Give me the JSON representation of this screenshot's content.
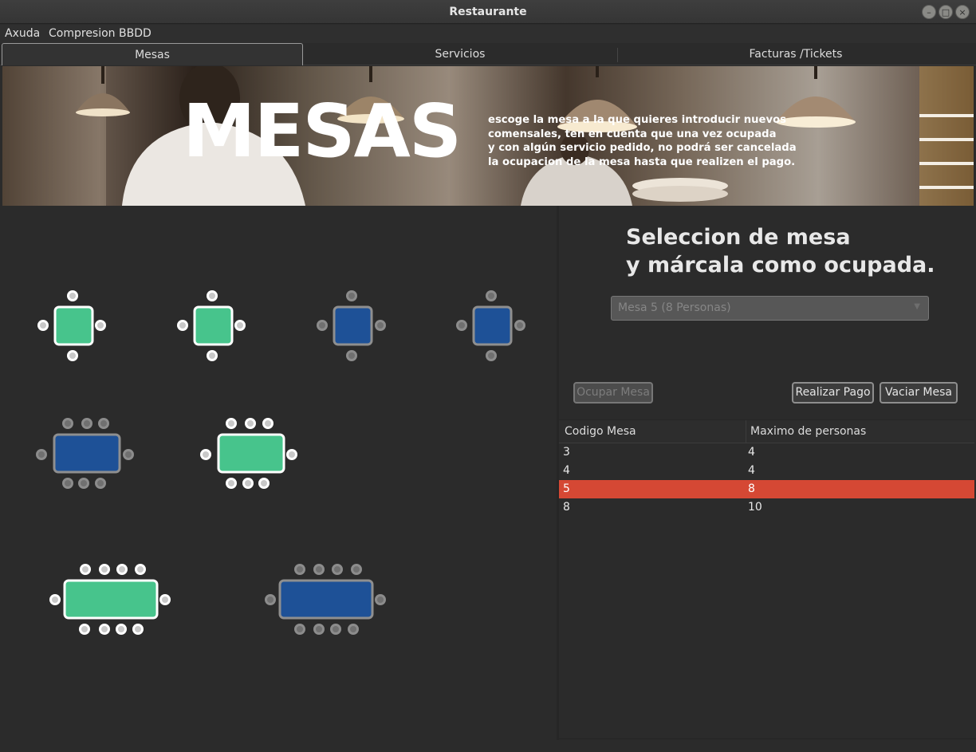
{
  "window": {
    "title": "Restaurante"
  },
  "menu": [
    {
      "label": "Axuda"
    },
    {
      "label": "Compresion BBDD"
    }
  ],
  "tabs": [
    {
      "label": "Mesas"
    },
    {
      "label": "Servicios"
    },
    {
      "label": "Facturas /Tickets"
    }
  ],
  "banner": {
    "title": "MESAS",
    "lines": [
      "escoge la mesa a la que quieres introducir nuevos",
      "comensales, ten en cuenta que una vez ocupada",
      "y con algún servicio pedido, no podrá ser cancelada",
      "la ocupacion de la mesa hasta que realizen el pago."
    ]
  },
  "panel": {
    "heading_line1": "Seleccion de mesa",
    "heading_line2": "y márcala como ocupada.",
    "combo_value": "Mesa 5 (8 Personas)",
    "buttons": {
      "ocupar": "Ocupar Mesa",
      "pago": "Realizar Pago",
      "vaciar": "Vaciar Mesa"
    }
  },
  "table": {
    "columns": [
      "Codigo Mesa",
      "Maximo de personas"
    ],
    "rows": [
      {
        "codigo": "3",
        "maximo": "4",
        "selected": false
      },
      {
        "codigo": "4",
        "maximo": "4",
        "selected": false
      },
      {
        "codigo": "5",
        "maximo": "8",
        "selected": true
      },
      {
        "codigo": "8",
        "maximo": "10",
        "selected": false
      }
    ]
  },
  "floor_tables": [
    {
      "status": "free"
    },
    {
      "status": "free"
    },
    {
      "status": "occupied"
    },
    {
      "status": "occupied"
    },
    {
      "status": "occupied"
    },
    {
      "status": "free"
    },
    {
      "status": "free"
    },
    {
      "status": "occupied"
    }
  ],
  "colors": {
    "free": "#47c48c",
    "occupied": "#1e5197",
    "selected_row": "#d54834"
  }
}
